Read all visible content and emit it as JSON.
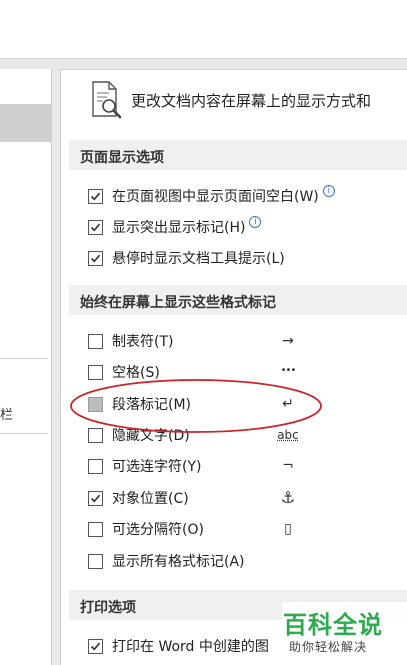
{
  "header": {
    "description": "更改文档内容在屏幕上的显示方式和"
  },
  "left_pane": {
    "fragment_text": "栏"
  },
  "sections": {
    "page_display": {
      "title": "页面显示选项",
      "items": [
        {
          "label": "在页面视图中显示页面间空白(W)",
          "checked": true,
          "info": true
        },
        {
          "label": "显示突出显示标记(H)",
          "checked": true,
          "info": true
        },
        {
          "label": "悬停时显示文档工具提示(L)",
          "checked": true,
          "info": false
        }
      ]
    },
    "formatting_marks": {
      "title": "始终在屏幕上显示这些格式标记",
      "items": [
        {
          "label": "制表符(T)",
          "checked": false,
          "symbol": "→"
        },
        {
          "label": "空格(S)",
          "checked": false,
          "symbol": "•••"
        },
        {
          "label": "段落标记(M)",
          "checked": false,
          "symbol": "↵",
          "highlighted": true
        },
        {
          "label": "隐藏文字(D)",
          "checked": false,
          "symbol": "abc"
        },
        {
          "label": "可选连字符(Y)",
          "checked": false,
          "symbol": "¬"
        },
        {
          "label": "对象位置(C)",
          "checked": true,
          "symbol": "⚓"
        },
        {
          "label": "可选分隔符(O)",
          "checked": false,
          "symbol": "▯"
        },
        {
          "label": "显示所有格式标记(A)",
          "checked": false,
          "symbol": ""
        }
      ]
    },
    "print": {
      "title": "打印选项",
      "items": [
        {
          "label": "打印在 Word 中创建的图",
          "checked": true
        }
      ]
    }
  },
  "watermark": {
    "title": "百科全说",
    "subtitle": "助你轻松解决"
  },
  "colors": {
    "annotation_ellipse": "#c8262b",
    "info_icon": "#3b77c7",
    "watermark_green": "#2eaa4f",
    "section_header_bg": "#f0f0f0"
  }
}
